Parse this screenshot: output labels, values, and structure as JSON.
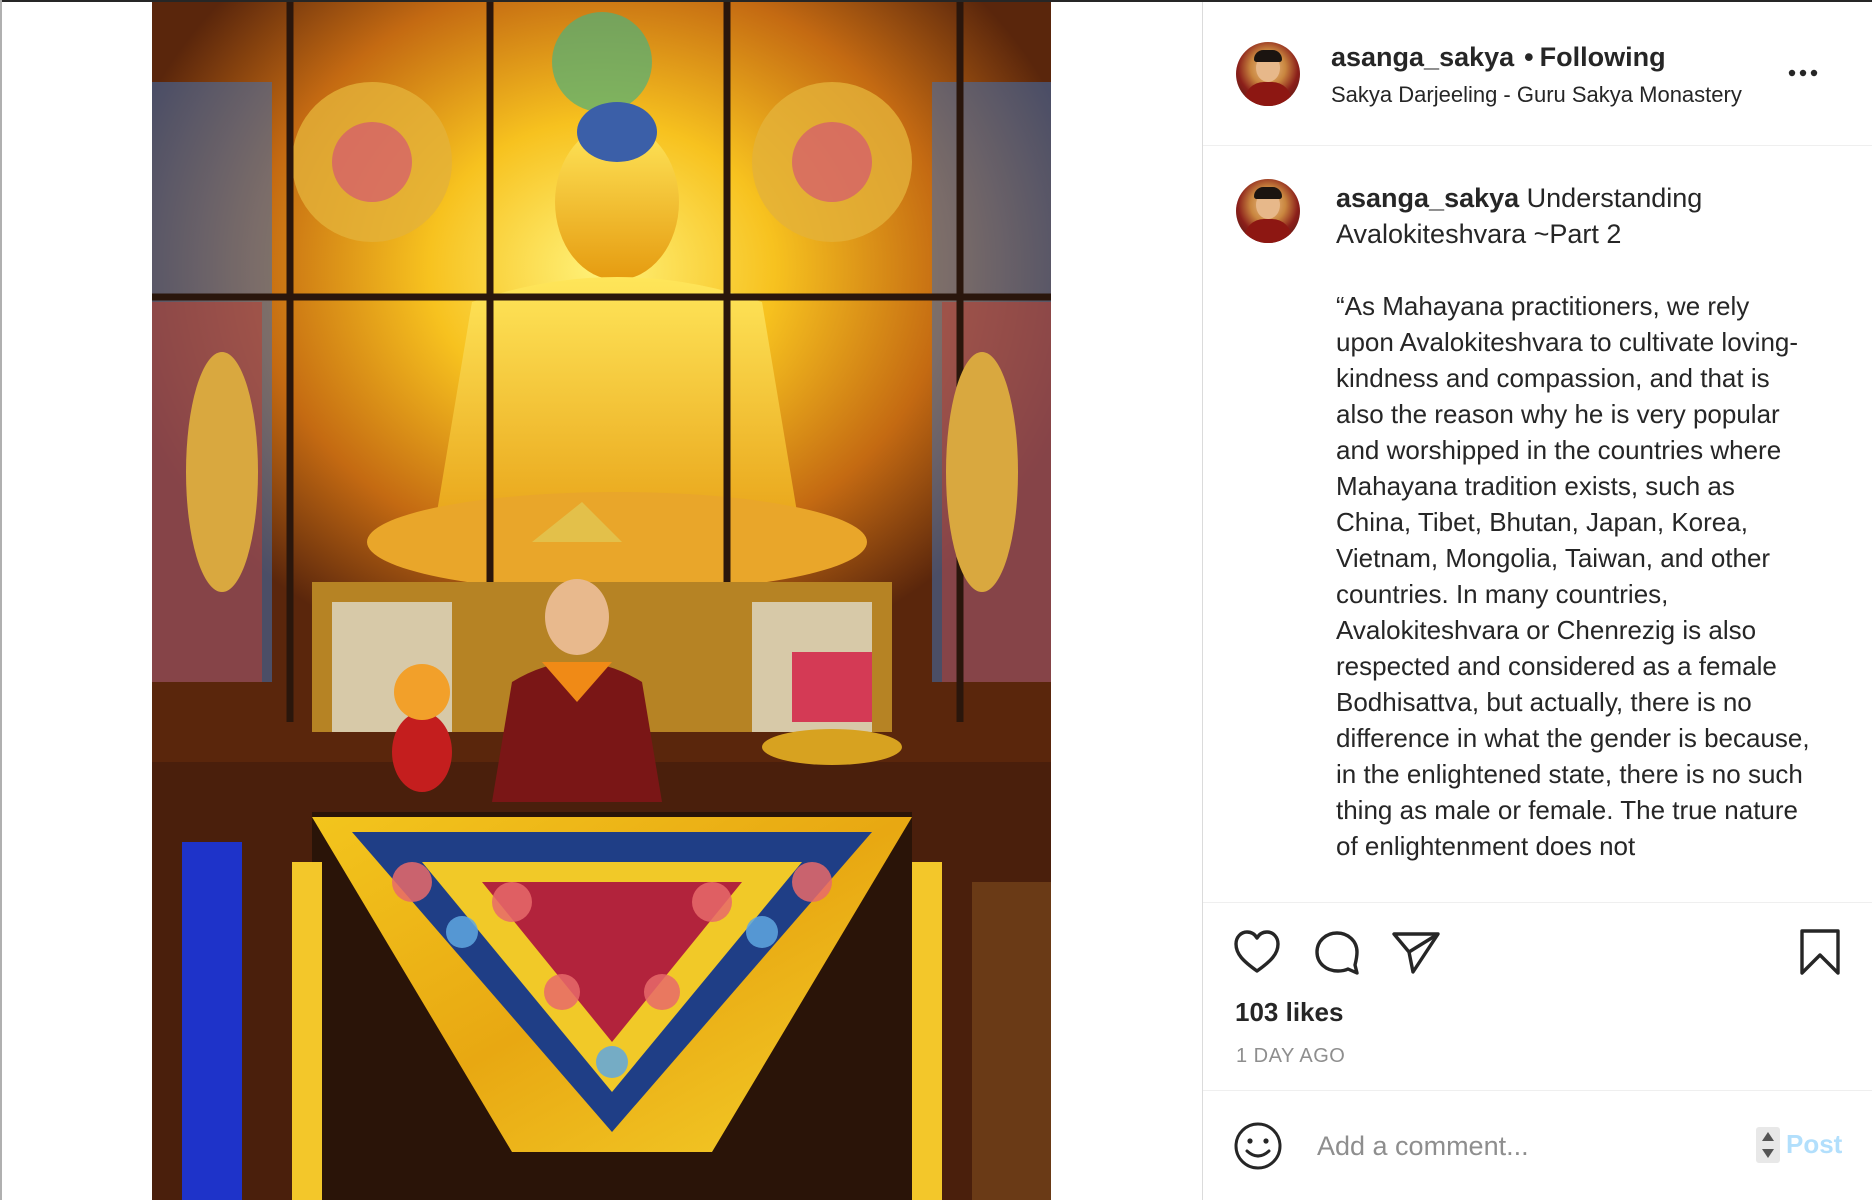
{
  "post": {
    "username": "asanga_sakya",
    "dot": "•",
    "follow_status": "Following",
    "location": "Sakya Darjeeling - Guru Sakya Monastery",
    "caption_title": "Understanding Avalokiteshvara ~Part 2",
    "caption_body": "“As Mahayana practitioners, we rely upon Avalokiteshvara to cultivate loving-kindness and compassion, and that is also the reason why he is very popular and worshipped in the countries where Mahayana tradition exists, such as China, Tibet, Bhutan, Japan, Korea, Vietnam, Mongolia, Taiwan, and other countries. In many countries, Avalokiteshvara or Chenrezig is also respected and considered as a female Bodhisattva, but actually, there is no difference in what the gender is because, in the enlightened state, there is no such thing as male or female. The true nature of enlightenment does not",
    "likes": "103 likes",
    "time_ago": "1 DAY AGO"
  },
  "comment": {
    "placeholder": "Add a comment...",
    "post_label": "Post"
  },
  "icons": {
    "more": "more-options-icon",
    "like": "heart-icon",
    "comment": "comment-bubble-icon",
    "share": "paper-plane-icon",
    "save": "bookmark-icon",
    "emoji": "smiley-icon"
  },
  "colors": {
    "text": "#262626",
    "muted": "#8e8e8e",
    "post_disabled": "#b2dffc",
    "divider": "#efefef"
  }
}
